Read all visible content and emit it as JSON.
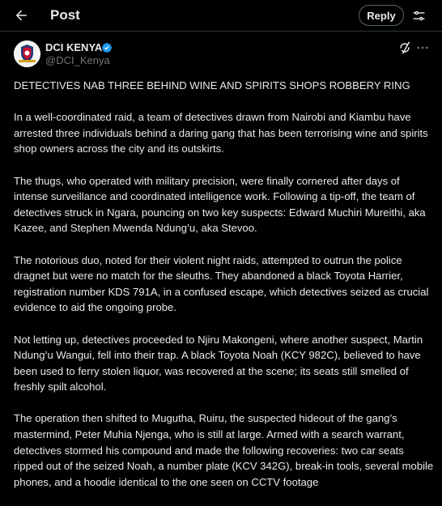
{
  "header": {
    "title": "Post",
    "reply_label": "Reply",
    "back_icon": "arrow-left-icon",
    "filter_icon": "sliders-icon"
  },
  "author": {
    "name": "DCI KENYA",
    "handle": "@DCI_Kenya",
    "verified": true,
    "avatar_icon": "police-crest-logo",
    "verified_color": "#1d9bf0"
  },
  "tweet": {
    "paragraphs": [
      "DETECTIVES NAB THREE BEHIND WINE AND SPIRITS SHOPS ROBBERY RING",
      "In a well-coordinated raid, a team of detectives drawn from Nairobi and Kiambu have arrested three individuals behind a daring gang that has been terrorising wine and spirits shop owners across the city and its outskirts.",
      "The thugs, who operated with military precision, were finally cornered after days of intense surveillance and coordinated intelligence work. Following a tip-off, the team of detectives struck in Ngara, pouncing on two key suspects: Edward Muchiri Mureithi, aka Kazee, and Stephen Mwenda Ndung’u, aka Stevoo.",
      "The notorious duo, noted for their violent night raids, attempted to outrun the police dragnet but were no match for the sleuths. They abandoned a black Toyota Harrier, registration number KDS 791A, in a confused escape, which detectives seized as crucial evidence to aid the ongoing probe.",
      "Not letting up, detectives proceeded to Njiru Makongeni, where another suspect, Martin Ndung’u Wangui, fell into their trap. A black Toyota Noah (KCY 982C), believed to have been used to ferry stolen liquor, was recovered at the scene; its seats still smelled of freshly spilt alcohol.",
      "The operation then shifted to Mugutha, Ruiru, the suspected hideout of the gang’s mastermind, Peter Muhia Njenga, who is still at large. Armed with a search warrant, detectives stormed his compound and made the following recoveries: two car seats ripped out of the seized Noah, a number plate (KCV 342G), break-in tools, several mobile phones, and a hoodie identical to the one seen on CCTV footage"
    ]
  },
  "colors": {
    "background": "#000000",
    "text": "#e7e9ea",
    "muted": "#71767b",
    "border": "#2f3336",
    "accent": "#1d9bf0"
  }
}
